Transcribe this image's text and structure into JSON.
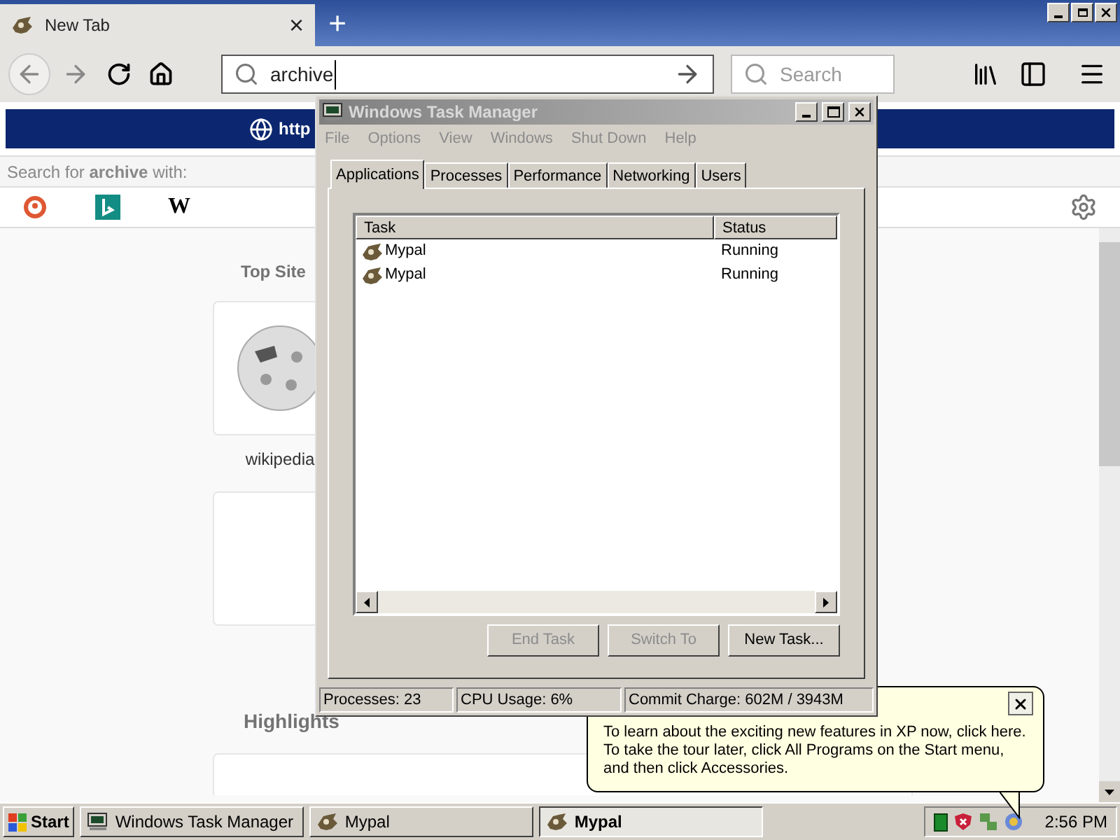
{
  "browser": {
    "tab": {
      "title": "New Tab",
      "close": "×"
    },
    "new_tab": "+",
    "url": "archive",
    "search_placeholder": "Search",
    "banner": "http",
    "search_with": "Search for **archive** with:",
    "wiki_engine": "W",
    "top_sites": {
      "heading": "Top Site",
      "tiles": [
        {
          "label": "wikipedia",
          "kind": "wiki"
        },
        {
          "kind": "empty"
        }
      ]
    },
    "highlights": {
      "heading": "Highlights"
    }
  },
  "task_manager": {
    "title": "Windows Task Manager",
    "menu": [
      {
        "label": "File",
        "disabled": true
      },
      {
        "label": "Options",
        "disabled": true
      },
      {
        "label": "View",
        "disabled": true
      },
      {
        "label": "Windows",
        "disabled": true
      },
      {
        "label": "Shut Down",
        "disabled": true
      },
      {
        "label": "Help",
        "disabled": true
      }
    ],
    "tabs": [
      {
        "label": "Applications",
        "selected": true
      },
      {
        "label": "Processes",
        "selected": false
      },
      {
        "label": "Performance",
        "selected": false
      },
      {
        "label": "Networking",
        "selected": false
      },
      {
        "label": "Users",
        "selected": false
      }
    ],
    "columns": [
      "Task",
      "Status"
    ],
    "rows": [
      {
        "task": "Mypal",
        "status": "Running"
      },
      {
        "task": "Mypal",
        "status": "Running"
      }
    ],
    "buttons": [
      {
        "label": "End Task",
        "disabled": true
      },
      {
        "label": "Switch To",
        "disabled": true
      },
      {
        "label": "New Task...",
        "disabled": false
      }
    ],
    "status_bar": [
      "Processes: 23",
      "CPU Usage: 6%",
      "Commit Charge: 602M / 3943M"
    ]
  },
  "balloon": {
    "lines": [
      "To learn about the exciting new features in XP now, click here.",
      "To take the tour later, click All Programs on the Start menu,",
      "and then click Accessories."
    ]
  },
  "taskbar": {
    "start": "Start",
    "buttons": [
      {
        "label": "Windows Task Manager",
        "kind": "taskmgr",
        "selected": false
      },
      {
        "label": "Mypal",
        "kind": "app",
        "selected": false
      },
      {
        "label": "Mypal",
        "kind": "app",
        "selected": true
      }
    ],
    "clock": "2:56 PM"
  }
}
